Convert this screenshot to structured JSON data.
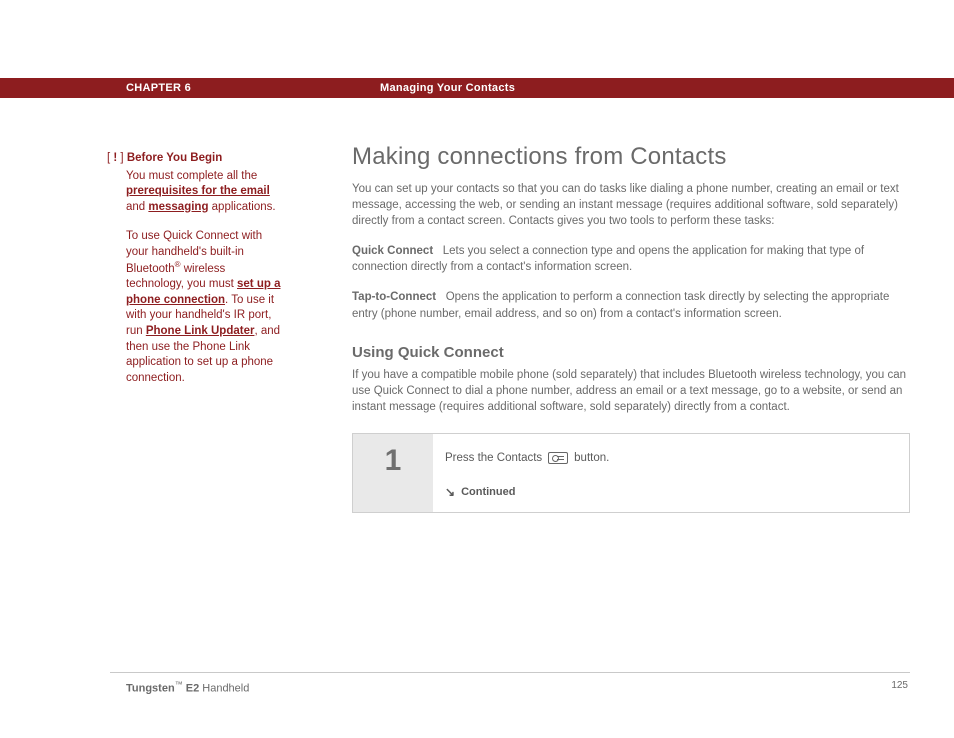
{
  "header": {
    "chapter": "CHAPTER 6",
    "section": "Managing Your Contacts"
  },
  "sidebar": {
    "marker_open": "[ ",
    "marker_bang": "!",
    "marker_close": " ]",
    "title": "Before You Begin",
    "p1_a": "You must complete all the ",
    "link1": "prerequisites for the email",
    "p1_b": " and ",
    "link2": "messaging",
    "p1_c": " applications.",
    "p2_a": "To use Quick Connect with your handheld's built-in Bluetooth",
    "reg": "®",
    "p2_b": " wireless technology, you must ",
    "link3": "set up a phone connection",
    "p2_c": ". To use it with your handheld's IR port, run ",
    "link4": "Phone Link Updater",
    "p2_d": ", and then use the Phone Link application to set up a phone connection."
  },
  "main": {
    "h1": "Making connections from Contacts",
    "intro": "You can set up your contacts so that you can do tasks like dialing a phone number, creating an email or text message, accessing the web, or sending an instant message (requires additional software, sold separately) directly from a contact screen. Contacts gives you two tools to perform these tasks:",
    "qc_term": "Quick Connect",
    "qc_gap": "   ",
    "qc_def": "Lets you select a connection type and opens the application for making that type of connection directly from a contact's information screen.",
    "ttc_term": "Tap-to-Connect",
    "ttc_gap": "   ",
    "ttc_def": "Opens the application to perform a connection task directly by selecting the appropriate entry (phone number, email address, and so on) from a contact's information screen.",
    "h2": "Using Quick Connect",
    "h2_body": "If you have a compatible mobile phone (sold separately) that includes Bluetooth wireless technology, you can use Quick Connect to dial a phone number, address an email or a text message, go to a website, or send an instant message (requires additional software, sold separately) directly from a contact.",
    "step_num": "1",
    "step_a": "Press the Contacts",
    "step_b": "button.",
    "continued": "Continued"
  },
  "footer": {
    "brand": "Tungsten",
    "tm": "™",
    "model": " E2",
    "tail": " Handheld",
    "page": "125"
  }
}
